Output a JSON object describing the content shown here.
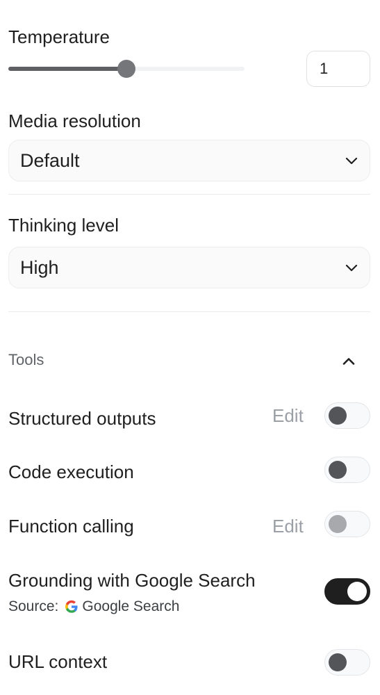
{
  "temperature": {
    "label": "Temperature",
    "value": "1",
    "slider_fraction": 0.5
  },
  "media_resolution": {
    "label": "Media resolution",
    "selected": "Default"
  },
  "thinking_level": {
    "label": "Thinking level",
    "selected": "High"
  },
  "tools": {
    "title": "Tools",
    "edit_label": "Edit",
    "structured_outputs": {
      "label": "Structured outputs",
      "enabled": false
    },
    "code_execution": {
      "label": "Code execution",
      "enabled": false
    },
    "function_calling": {
      "label": "Function calling",
      "enabled": false
    },
    "grounding": {
      "label": "Grounding with Google Search",
      "source_prefix": "Source:",
      "source_name": "Google Search",
      "enabled": true
    },
    "url_context": {
      "label": "URL context",
      "enabled": false
    }
  },
  "icons": {
    "select_chevron": "chevron-down-icon",
    "collapse": "chevron-up-icon",
    "source": "google-g-icon"
  },
  "colors": {
    "toggle_on": "#1f1f1f",
    "toggle_off_knob": "#545559",
    "muted_text": "#9aa0a6"
  }
}
